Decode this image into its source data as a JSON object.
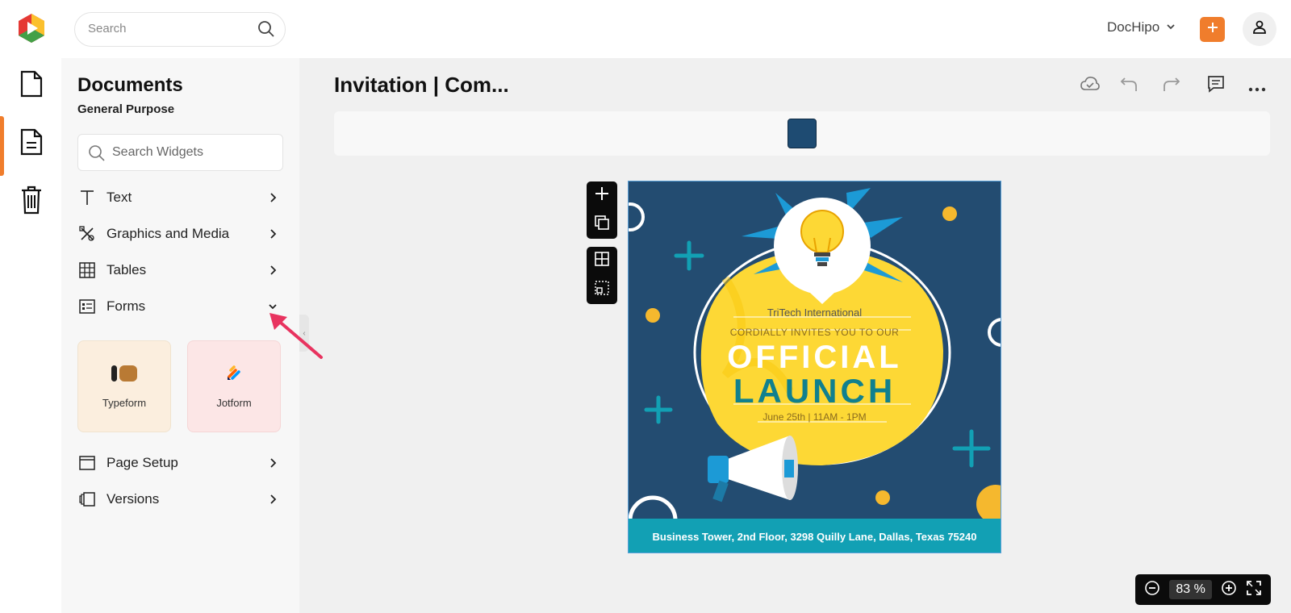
{
  "header": {
    "search_placeholder": "Search",
    "workspace_label": "DocHipo",
    "accent_color": "#f07d2c"
  },
  "sidebar_rail": {
    "items": [
      {
        "icon": "document-icon",
        "active": false
      },
      {
        "icon": "file-text-icon",
        "active": true
      },
      {
        "icon": "trash-icon",
        "active": false
      }
    ]
  },
  "panel": {
    "title": "Documents",
    "subtitle": "General Purpose",
    "search_placeholder": "Search Widgets",
    "menu": [
      {
        "label": "Text",
        "icon": "text-icon",
        "expanded": false
      },
      {
        "label": "Graphics and Media",
        "icon": "graphics-icon",
        "expanded": false
      },
      {
        "label": "Tables",
        "icon": "table-icon",
        "expanded": false
      },
      {
        "label": "Forms",
        "icon": "forms-icon",
        "expanded": true
      },
      {
        "label": "Page Setup",
        "icon": "page-setup-icon",
        "expanded": false
      },
      {
        "label": "Versions",
        "icon": "versions-icon",
        "expanded": false
      }
    ],
    "form_widgets": [
      {
        "label": "Typeform"
      },
      {
        "label": "Jotform"
      }
    ]
  },
  "editor": {
    "doc_title": "Invitation | Com...",
    "selected_color": "#1e4b72",
    "zoom_percent": "83",
    "zoom_unit": "%"
  },
  "flyer": {
    "company": "TriTech International",
    "invites": "CORDIALLY INVITES YOU TO OUR",
    "headline1": "OFFICIAL",
    "headline2": "LAUNCH",
    "date": "June 25th | 11AM - 1PM",
    "address": "Business Tower, 2nd Floor, 3298 Quilly Lane, Dallas, Texas 75240"
  }
}
